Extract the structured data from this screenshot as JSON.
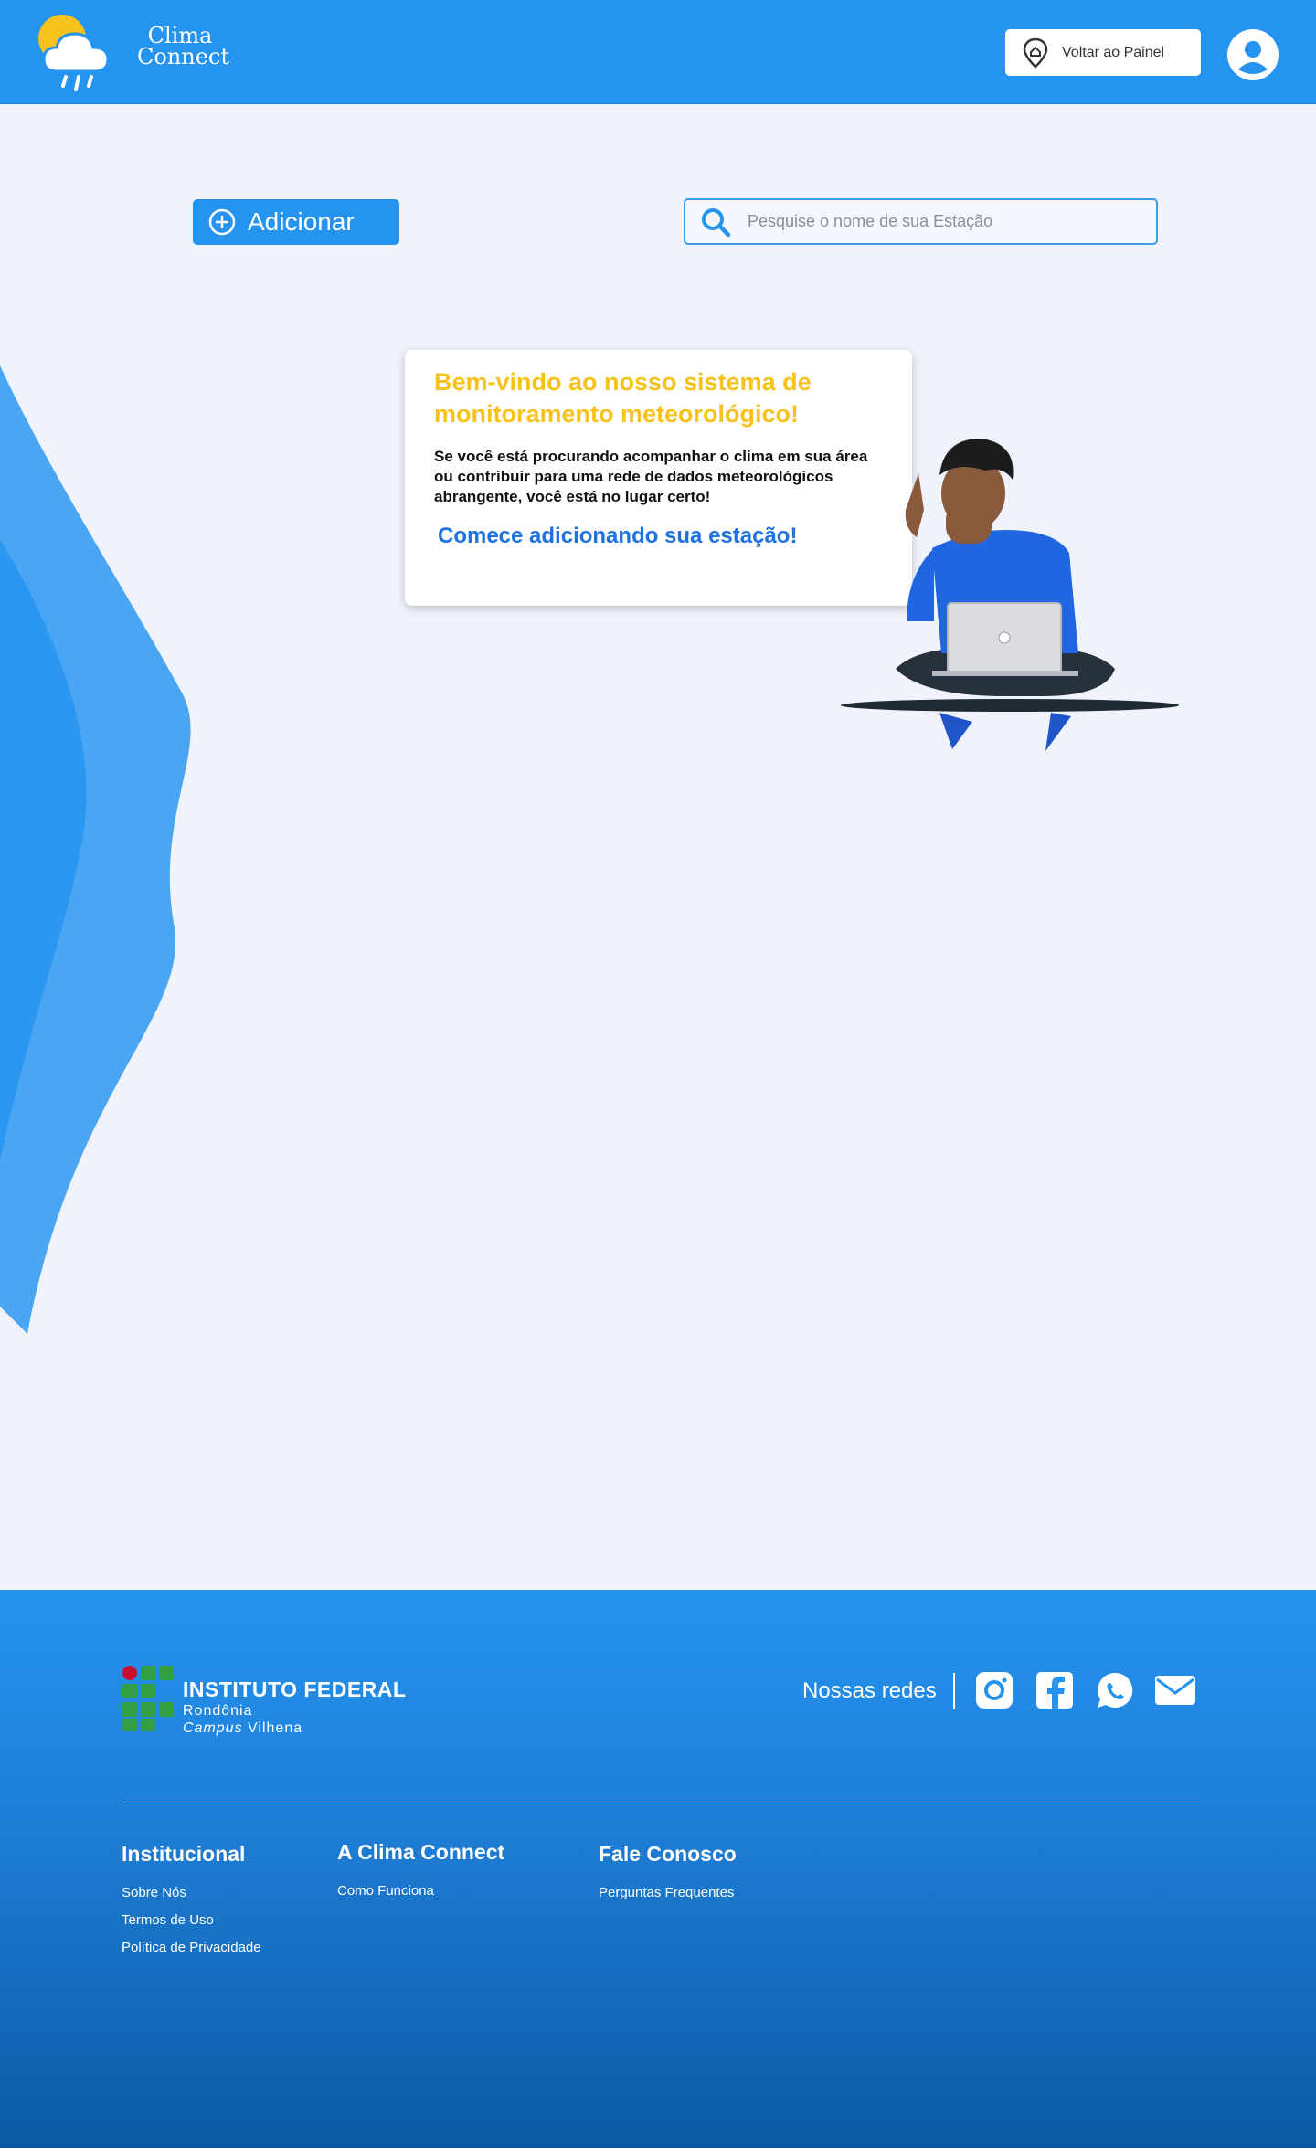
{
  "header": {
    "brand_line1": "Clima",
    "brand_line2": "Connect",
    "back_label": "Voltar ao Painel"
  },
  "toolbar": {
    "add_label": "Adicionar",
    "search_placeholder": "Pesquise o nome de sua Estação"
  },
  "welcome": {
    "title": "Bem-vindo ao nosso sistema de monitoramento meteorológico!",
    "text": "Se você está procurando acompanhar o clima em sua área ou contribuir para uma rede de dados meteorológicos abrangente, você está no lugar certo!",
    "cta": "Comece adicionando sua estação!"
  },
  "footer": {
    "institution": {
      "title": "INSTITUTO FEDERAL",
      "line2": "Rondônia",
      "line3a": "Campus",
      "line3b": " Vilhena"
    },
    "social_label": "Nossas redes",
    "social": [
      "instagram-icon",
      "facebook-icon",
      "whatsapp-icon",
      "email-icon"
    ],
    "columns": [
      {
        "title": "Institucional",
        "links": [
          "Sobre Nós",
          "Termos de Uso",
          "Política de Privacidade"
        ]
      },
      {
        "title": "A Clima Connect",
        "links": [
          "Como Funciona"
        ]
      },
      {
        "title": "Fale Conosco",
        "links": [
          "Perguntas Frequentes"
        ]
      }
    ]
  },
  "colors": {
    "primary": "#2494f0",
    "accent_yellow": "#f7c21c",
    "cta_blue": "#1f72e0",
    "background": "#f0f3fb"
  }
}
